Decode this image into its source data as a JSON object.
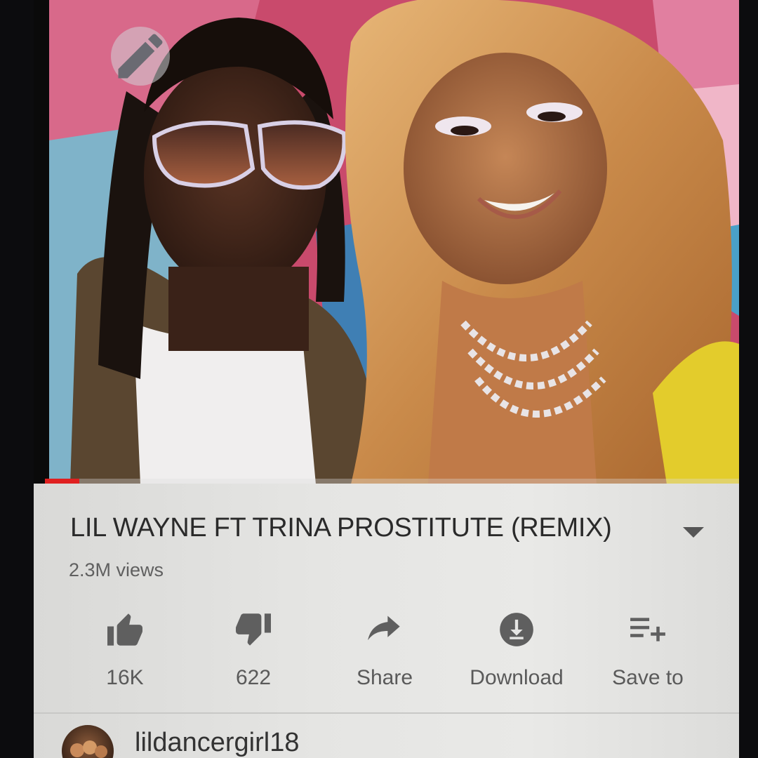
{
  "video": {
    "title": "LIL WAYNE FT TRINA PROSTITUTE (REMIX)",
    "views": "2.3M views",
    "progress_fraction": 0.05,
    "icons": {
      "edit": "pencil-icon",
      "expand": "caret-down-icon"
    }
  },
  "actions": [
    {
      "label": "16K",
      "icon": "thumbs-up-icon"
    },
    {
      "label": "622",
      "icon": "thumbs-down-icon"
    },
    {
      "label": "Share",
      "icon": "share-icon"
    },
    {
      "label": "Download",
      "icon": "download-icon"
    },
    {
      "label": "Save to",
      "icon": "playlist-add-icon"
    }
  ],
  "channel": {
    "name": "lildancergirl18"
  },
  "colors": {
    "accent": "#e02020",
    "icon": "#5f5f5f",
    "text": "#2a2a2a"
  }
}
